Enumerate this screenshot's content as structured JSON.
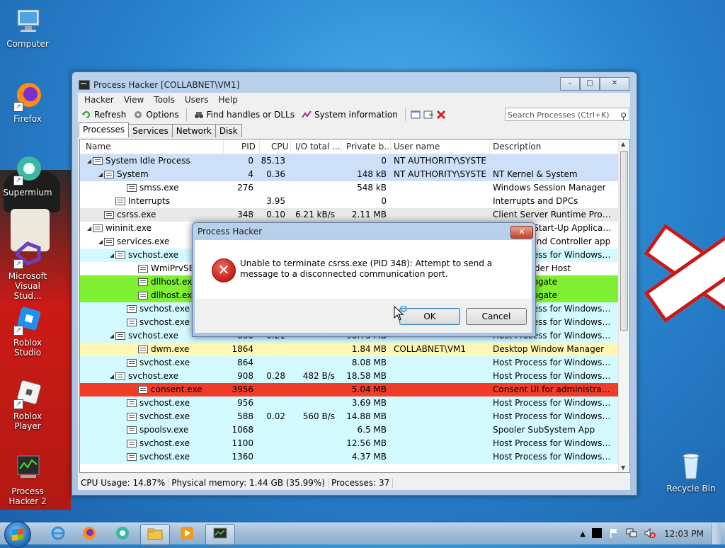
{
  "desktop": {
    "icons": [
      {
        "label": "Computer"
      },
      {
        "label": "Firefox"
      },
      {
        "label": "Supermium"
      },
      {
        "label": "Microsoft Visual Stud..."
      },
      {
        "label": "Roblox Studio"
      },
      {
        "label": "Roblox Player"
      },
      {
        "label": "Process Hacker 2"
      },
      {
        "label": "Recycle Bin"
      }
    ]
  },
  "window": {
    "title": "Process Hacker [COLLABNET\\VM1]",
    "caption_buttons": {
      "minimize": "–",
      "maximize": "□",
      "close": "✕"
    },
    "menu": [
      "Hacker",
      "View",
      "Tools",
      "Users",
      "Help"
    ],
    "toolbar": {
      "refresh": "Refresh",
      "options": "Options",
      "find_handles": "Find handles or DLLs",
      "system_info": "System information"
    },
    "search_placeholder": "Search Processes (Ctrl+K)",
    "tabs": [
      "Processes",
      "Services",
      "Network",
      "Disk"
    ],
    "columns": [
      "Name",
      "PID",
      "CPU",
      "I/O total ...",
      "Private b...",
      "User name",
      "Description"
    ],
    "rows": [
      {
        "name": "System Idle Process",
        "indent": 0,
        "tw": "◢",
        "pid": "0",
        "cpu": "85.13",
        "io": "",
        "priv": "0",
        "user": "NT AUTHORITY\\SYSTEM",
        "desc": "",
        "bg": "#cde0f7"
      },
      {
        "name": "System",
        "indent": 1,
        "tw": "◢",
        "pid": "4",
        "cpu": "0.36",
        "io": "",
        "priv": "148 kB",
        "user": "NT AUTHORITY\\SYSTEM",
        "desc": "NT Kernel & System",
        "bg": "#cde0f7"
      },
      {
        "name": "smss.exe",
        "indent": 3,
        "tw": "",
        "pid": "276",
        "cpu": "",
        "io": "",
        "priv": "548 kB",
        "user": "",
        "desc": "Windows Session Manager",
        "bg": "#ffffff"
      },
      {
        "name": "Interrupts",
        "indent": 2,
        "tw": "",
        "pid": "",
        "cpu": "3.95",
        "io": "",
        "priv": "0",
        "user": "",
        "desc": "Interrupts and DPCs",
        "bg": "#ffffff"
      },
      {
        "name": "csrss.exe",
        "indent": 1,
        "tw": "",
        "pid": "348",
        "cpu": "0.10",
        "io": "6.21 kB/s",
        "priv": "2.11 MB",
        "user": "",
        "desc": "Client Server Runtime Process",
        "bg": "#e9e9e9"
      },
      {
        "name": "wininit.exe",
        "indent": 0,
        "tw": "◢",
        "pid": "",
        "cpu": "",
        "io": "",
        "priv": "",
        "user": "",
        "desc": "Windows Start-Up Application",
        "bg": "#ffffff"
      },
      {
        "name": "services.exe",
        "indent": 1,
        "tw": "◢",
        "pid": "",
        "cpu": "",
        "io": "",
        "priv": "",
        "user": "",
        "desc": "Services and Controller app",
        "bg": "#ffffff"
      },
      {
        "name": "svchost.exe",
        "indent": 2,
        "tw": "◢",
        "pid": "",
        "cpu": "",
        "io": "",
        "priv": "",
        "user": "",
        "desc": "Host Process for Windows Ser...",
        "bg": "#d3fbff"
      },
      {
        "name": "WmiPrvSE.exe",
        "indent": 4,
        "tw": "",
        "pid": "",
        "cpu": "",
        "io": "",
        "priv": "",
        "user": "",
        "desc": "WMI Provider Host",
        "bg": "#ffffff"
      },
      {
        "name": "dllhost.exe",
        "indent": 4,
        "tw": "",
        "pid": "",
        "cpu": "",
        "io": "",
        "priv": "",
        "user": "",
        "desc": "COM Surrogate",
        "bg": "#80f033"
      },
      {
        "name": "dllhost.exe",
        "indent": 4,
        "tw": "",
        "pid": "",
        "cpu": "",
        "io": "",
        "priv": "",
        "user": "",
        "desc": "COM Surrogate",
        "bg": "#80f033"
      },
      {
        "name": "svchost.exe",
        "indent": 3,
        "tw": "",
        "pid": "",
        "cpu": "",
        "io": "",
        "priv": "",
        "user": "",
        "desc": "Host Process for Windows Ser...",
        "bg": "#d3fbff"
      },
      {
        "name": "svchost.exe",
        "indent": 3,
        "tw": "",
        "pid": "",
        "cpu": "",
        "io": "",
        "priv": "",
        "user": "",
        "desc": "Host Process for Windows Ser...",
        "bg": "#d3fbff"
      },
      {
        "name": "svchost.exe",
        "indent": 2,
        "tw": "◢",
        "pid": "836",
        "cpu": "0.21",
        "io": "",
        "priv": "98.75 MB",
        "user": "",
        "desc": "Host Process for Windows Ser...",
        "bg": "#d3fbff"
      },
      {
        "name": "dwm.exe",
        "indent": 4,
        "tw": "",
        "pid": "1864",
        "cpu": "",
        "io": "",
        "priv": "1.84 MB",
        "user": "COLLABNET\\VM1",
        "desc": "Desktop Window Manager",
        "bg": "#fff7b4"
      },
      {
        "name": "svchost.exe",
        "indent": 3,
        "tw": "",
        "pid": "864",
        "cpu": "",
        "io": "",
        "priv": "8.08 MB",
        "user": "",
        "desc": "Host Process for Windows Ser...",
        "bg": "#d3fbff"
      },
      {
        "name": "svchost.exe",
        "indent": 2,
        "tw": "◢",
        "pid": "908",
        "cpu": "0.28",
        "io": "482 B/s",
        "priv": "18.58 MB",
        "user": "",
        "desc": "Host Process for Windows Ser...",
        "bg": "#d3fbff"
      },
      {
        "name": "consent.exe",
        "indent": 4,
        "tw": "",
        "pid": "3956",
        "cpu": "",
        "io": "",
        "priv": "5.04 MB",
        "user": "",
        "desc": "Consent UI for administrative ...",
        "bg": "#f03c28"
      },
      {
        "name": "svchost.exe",
        "indent": 3,
        "tw": "",
        "pid": "956",
        "cpu": "",
        "io": "",
        "priv": "3.69 MB",
        "user": "",
        "desc": "Host Process for Windows Ser...",
        "bg": "#d3fbff"
      },
      {
        "name": "svchost.exe",
        "indent": 3,
        "tw": "",
        "pid": "588",
        "cpu": "0.02",
        "io": "560 B/s",
        "priv": "14.88 MB",
        "user": "",
        "desc": "Host Process for Windows Ser...",
        "bg": "#d3fbff"
      },
      {
        "name": "spoolsv.exe",
        "indent": 3,
        "tw": "",
        "pid": "1068",
        "cpu": "",
        "io": "",
        "priv": "6.5 MB",
        "user": "",
        "desc": "Spooler SubSystem App",
        "bg": "#d3fbff"
      },
      {
        "name": "svchost.exe",
        "indent": 3,
        "tw": "",
        "pid": "1100",
        "cpu": "",
        "io": "",
        "priv": "12.56 MB",
        "user": "",
        "desc": "Host Process for Windows Ser...",
        "bg": "#d3fbff"
      },
      {
        "name": "svchost.exe",
        "indent": 3,
        "tw": "",
        "pid": "1360",
        "cpu": "",
        "io": "",
        "priv": "4.37 MB",
        "user": "",
        "desc": "Host Process for Windows Ser...",
        "bg": "#d3fbff"
      }
    ],
    "status": {
      "cpu": "CPU Usage: 14.87%",
      "memory": "Physical memory: 1.44 GB (35.99%)",
      "processes": "Processes: 37"
    }
  },
  "dialog": {
    "title": "Process Hacker",
    "close": "✕",
    "message": "Unable to terminate csrss.exe (PID 348): Attempt to send a message to a disconnected communication port.",
    "ok": "OK",
    "cancel": "Cancel",
    "icon": "error-icon"
  },
  "taskbar": {
    "clock": "12:03 PM"
  }
}
